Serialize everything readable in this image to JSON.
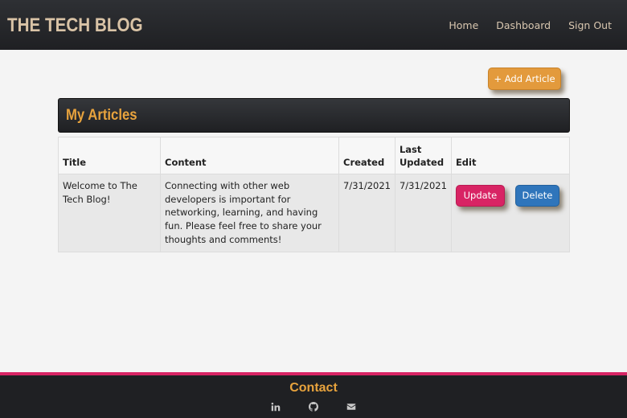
{
  "navbar": {
    "brand": "THE TECH BLOG",
    "links": [
      {
        "label": "Home"
      },
      {
        "label": "Dashboard"
      },
      {
        "label": "Sign Out"
      }
    ]
  },
  "actions": {
    "add_article_label": "+ Add Article"
  },
  "section": {
    "title": "My Articles"
  },
  "table": {
    "headers": {
      "title": "Title",
      "content": "Content",
      "created": "Created",
      "last_updated": "Last Updated",
      "edit": "Edit"
    },
    "rows": [
      {
        "title": "Welcome to The Tech Blog!",
        "content": "Connecting with other web developers is important for networking, learning, and having fun. Please feel free to share your thoughts and comments!",
        "created": "7/31/2021",
        "last_updated": "7/31/2021",
        "update_label": "Update",
        "delete_label": "Delete"
      }
    ]
  },
  "footer": {
    "title": "Contact",
    "icons": [
      "linkedin-icon",
      "github-icon",
      "envelope-icon"
    ]
  },
  "colors": {
    "accent_orange": "#e8a33d",
    "update_pink": "#d82464",
    "delete_blue": "#2f75bb",
    "dark_bg": "#1f2023"
  }
}
